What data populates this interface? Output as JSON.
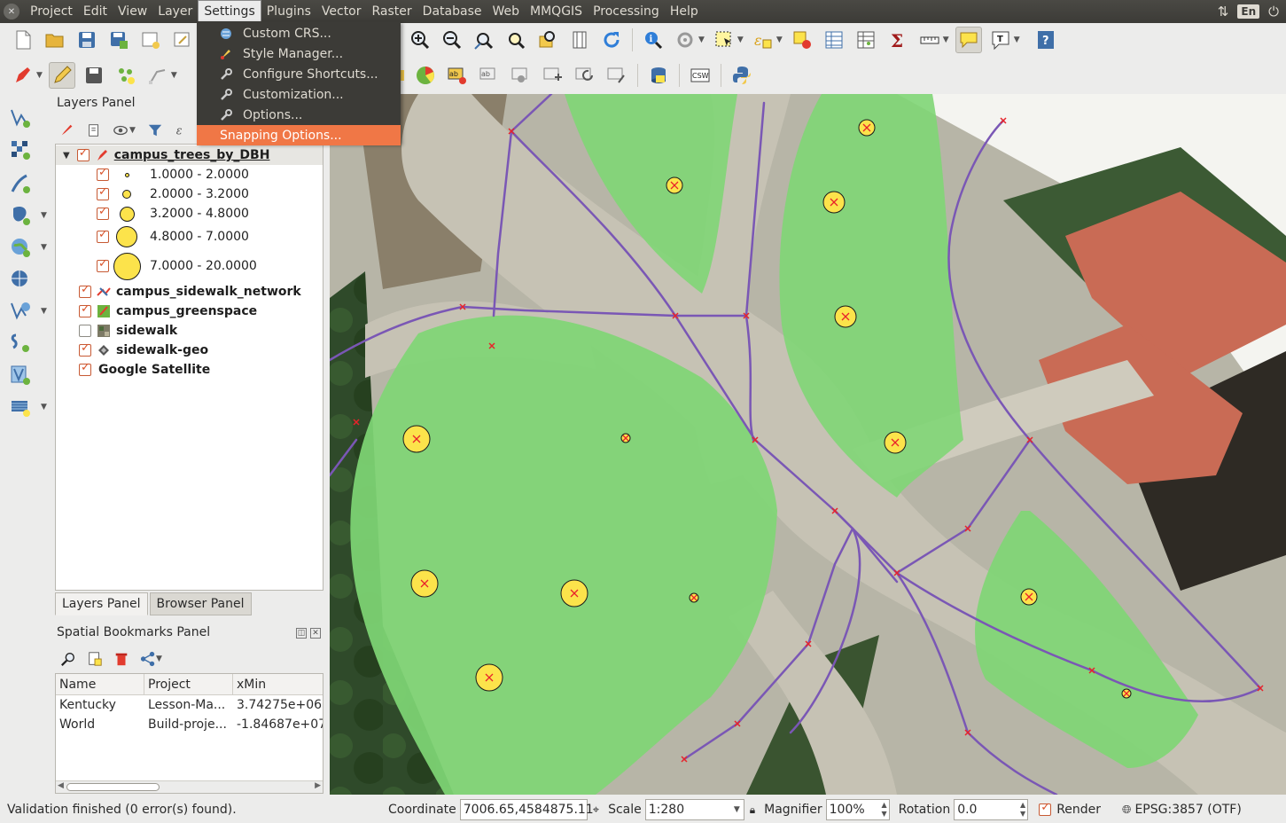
{
  "menubar": {
    "items": [
      "Project",
      "Edit",
      "View",
      "Layer",
      "Settings",
      "Plugins",
      "Vector",
      "Raster",
      "Database",
      "Web",
      "MMQGIS",
      "Processing",
      "Help"
    ],
    "active": "Settings",
    "keyboard_layout": "En"
  },
  "settings_menu": {
    "items": [
      {
        "label": "Custom CRS...",
        "icon": "globe-crs-icon"
      },
      {
        "label": "Style Manager...",
        "icon": "paintbrush-icon"
      },
      {
        "label": "Configure Shortcuts...",
        "icon": "wrench-icon"
      },
      {
        "label": "Customization...",
        "icon": "wrench-icon"
      },
      {
        "label": "Options...",
        "icon": "wrench-icon"
      },
      {
        "label": "Snapping Options...",
        "icon": "",
        "highlighted": true
      }
    ]
  },
  "layers_panel": {
    "title": "Layers Panel",
    "layers": [
      {
        "label": "campus_trees_by_DBH",
        "checked": true,
        "bold": true,
        "underline": true,
        "selected": true,
        "expanded": true
      },
      {
        "label": "1.0000 - 2.0000",
        "checked": true,
        "legend": true,
        "size": 5
      },
      {
        "label": "2.0000 - 3.2000",
        "checked": true,
        "legend": true,
        "size": 10
      },
      {
        "label": "3.2000 - 4.8000",
        "checked": true,
        "legend": true,
        "size": 16
      },
      {
        "label": "4.8000 - 7.0000",
        "checked": true,
        "legend": true,
        "size": 24
      },
      {
        "label": "7.0000 - 20.0000",
        "checked": true,
        "legend": true,
        "size": 32
      },
      {
        "label": "campus_sidewalk_network",
        "checked": true,
        "bold": true
      },
      {
        "label": "campus_greenspace",
        "checked": true,
        "bold": true
      },
      {
        "label": "sidewalk",
        "checked": false,
        "bold": true
      },
      {
        "label": "sidewalk-geo",
        "checked": true,
        "bold": true
      },
      {
        "label": "Google Satellite",
        "checked": true,
        "bold": true
      }
    ]
  },
  "tabs": [
    "Layers Panel",
    "Browser Panel"
  ],
  "bookmarks": {
    "title": "Spatial Bookmarks Panel",
    "columns": [
      "Name",
      "Project",
      "xMin"
    ],
    "rows": [
      [
        "Kentucky",
        "Lesson-Ma...",
        "3.74275e+06"
      ],
      [
        "World",
        "Build-proje...",
        "-1.84687e+07"
      ]
    ]
  },
  "statusbar": {
    "message": "Validation finished (0 error(s) found).",
    "coordinate_label": "Coordinate",
    "coordinate": "7006.65,4584875.11",
    "scale_label": "Scale",
    "scale": "1:280",
    "magnifier_label": "Magnifier",
    "magnifier": "100%",
    "rotation_label": "Rotation",
    "rotation": "0.0",
    "render_label": "Render",
    "render_checked": true,
    "crs": "EPSG:3857 (OTF)"
  },
  "colors": {
    "menu_bg": "#3c3b37",
    "menu_highlight": "#f07746",
    "greenspace": "#7fd675",
    "sidewalk_line": "#7a57b5",
    "tree_symbol": "#fce34b",
    "vertex_marker": "#e8232a"
  }
}
